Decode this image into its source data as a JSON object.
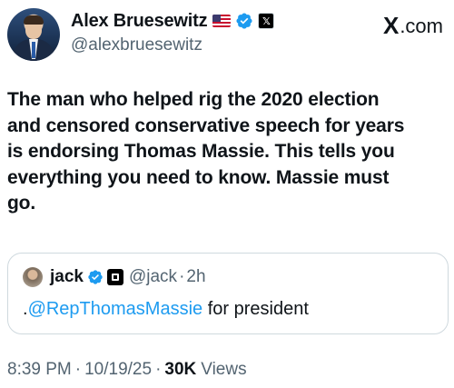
{
  "author": {
    "name": "Alex Bruesewitz",
    "handle": "@alexbruesewitz"
  },
  "brand": {
    "logo": "X",
    "suffix": ".com"
  },
  "tweet": {
    "line1": "The man who helped rig the 2020 election",
    "line2": "and censored conservative speech for years",
    "line3": "is endorsing Thomas Massie. This tells you",
    "line4": "everything you need to know. Massie must",
    "line5": "go."
  },
  "quoted": {
    "name": "jack",
    "handle": "@jack",
    "separator": "·",
    "time": "2h",
    "text_prefix": ".",
    "mention": "@RepThomasMassie",
    "text_suffix": " for president"
  },
  "footer": {
    "time": "8:39 PM",
    "sep1": "·",
    "date": "10/19/25",
    "sep2": "·",
    "views_count": "30K",
    "views_label": "Views"
  },
  "colors": {
    "accent": "#1d9bf0",
    "text": "#0f1419",
    "muted": "#536471",
    "border": "#cfd9de"
  },
  "icons": [
    "us-flag-icon",
    "verified-badge-icon",
    "x-affiliate-badge-icon",
    "x-logo-icon",
    "square-affiliate-badge-icon"
  ]
}
